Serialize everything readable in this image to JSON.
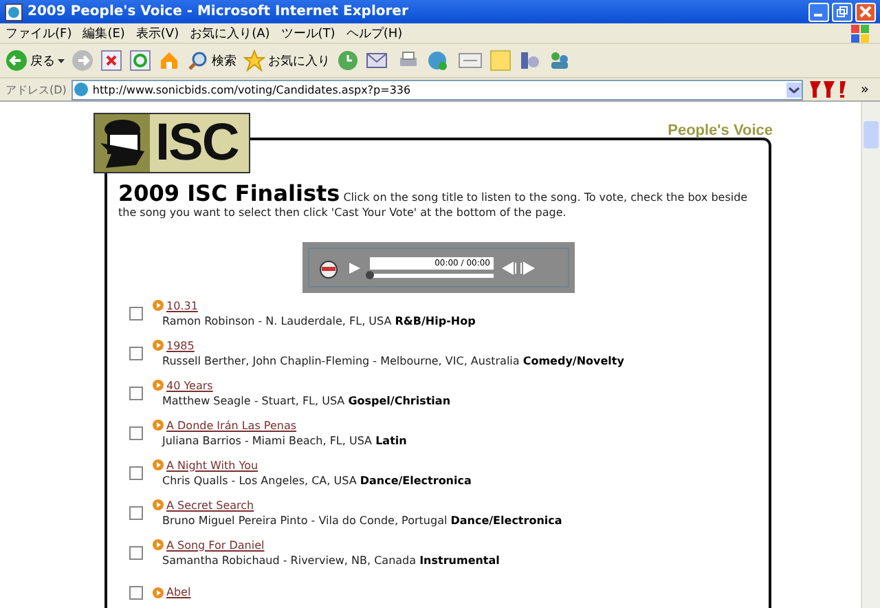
{
  "window": {
    "title": "2009 People's Voice - Microsoft Internet Explorer"
  },
  "menu": [
    "ファイル(F)",
    "編集(E)",
    "表示(V)",
    "お気に入り(A)",
    "ツール(T)",
    "ヘルプ(H)"
  ],
  "toolbar": {
    "back": "戻る",
    "search": "検索",
    "favorites": "お気に入り"
  },
  "address": {
    "label": "アドレス(D)",
    "url": "http://www.sonicbids.com/voting/Candidates.aspx?p=336",
    "more": "»"
  },
  "page": {
    "logo": "ISC",
    "tagline": "People's Voice",
    "heading": "2009 ISC Finalists",
    "intro": "Click on the song title to listen to the song. To vote, check the box beside the song you want to select then click 'Cast Your Vote' at the bottom of the page.",
    "player": {
      "time": "00:00 / 00:00",
      "level": 0.0
    },
    "songs": [
      {
        "title": "10.31",
        "details": "Ramon Robinson - N. Lauderdale, FL, USA",
        "genre": "R&B/Hip-Hop",
        "checked": false
      },
      {
        "title": "1985",
        "details": "Russell Berther, John Chaplin-Fleming - Melbourne, VIC, Australia",
        "genre": "Comedy/Novelty",
        "checked": false
      },
      {
        "title": "40 Years",
        "details": "Matthew Seagle - Stuart, FL, USA",
        "genre": "Gospel/Christian",
        "checked": false
      },
      {
        "title": "A Donde Irán Las Penas",
        "details": "Juliana Barrios - Miami Beach, FL, USA",
        "genre": "Latin",
        "checked": false
      },
      {
        "title": "A Night With You",
        "details": "Chris Qualls - Los Angeles, CA, USA",
        "genre": "Dance/Electronica",
        "checked": false
      },
      {
        "title": "A Secret Search",
        "details": "Bruno Miguel Pereira Pinto - Vila do Conde, Portugal",
        "genre": "Dance/Electronica",
        "checked": false
      },
      {
        "title": "A Song For Daniel",
        "details": "Samantha Robichaud - Riverview, NB, Canada",
        "genre": "Instrumental",
        "checked": false
      },
      {
        "title": "Abel",
        "checked": false
      }
    ]
  }
}
